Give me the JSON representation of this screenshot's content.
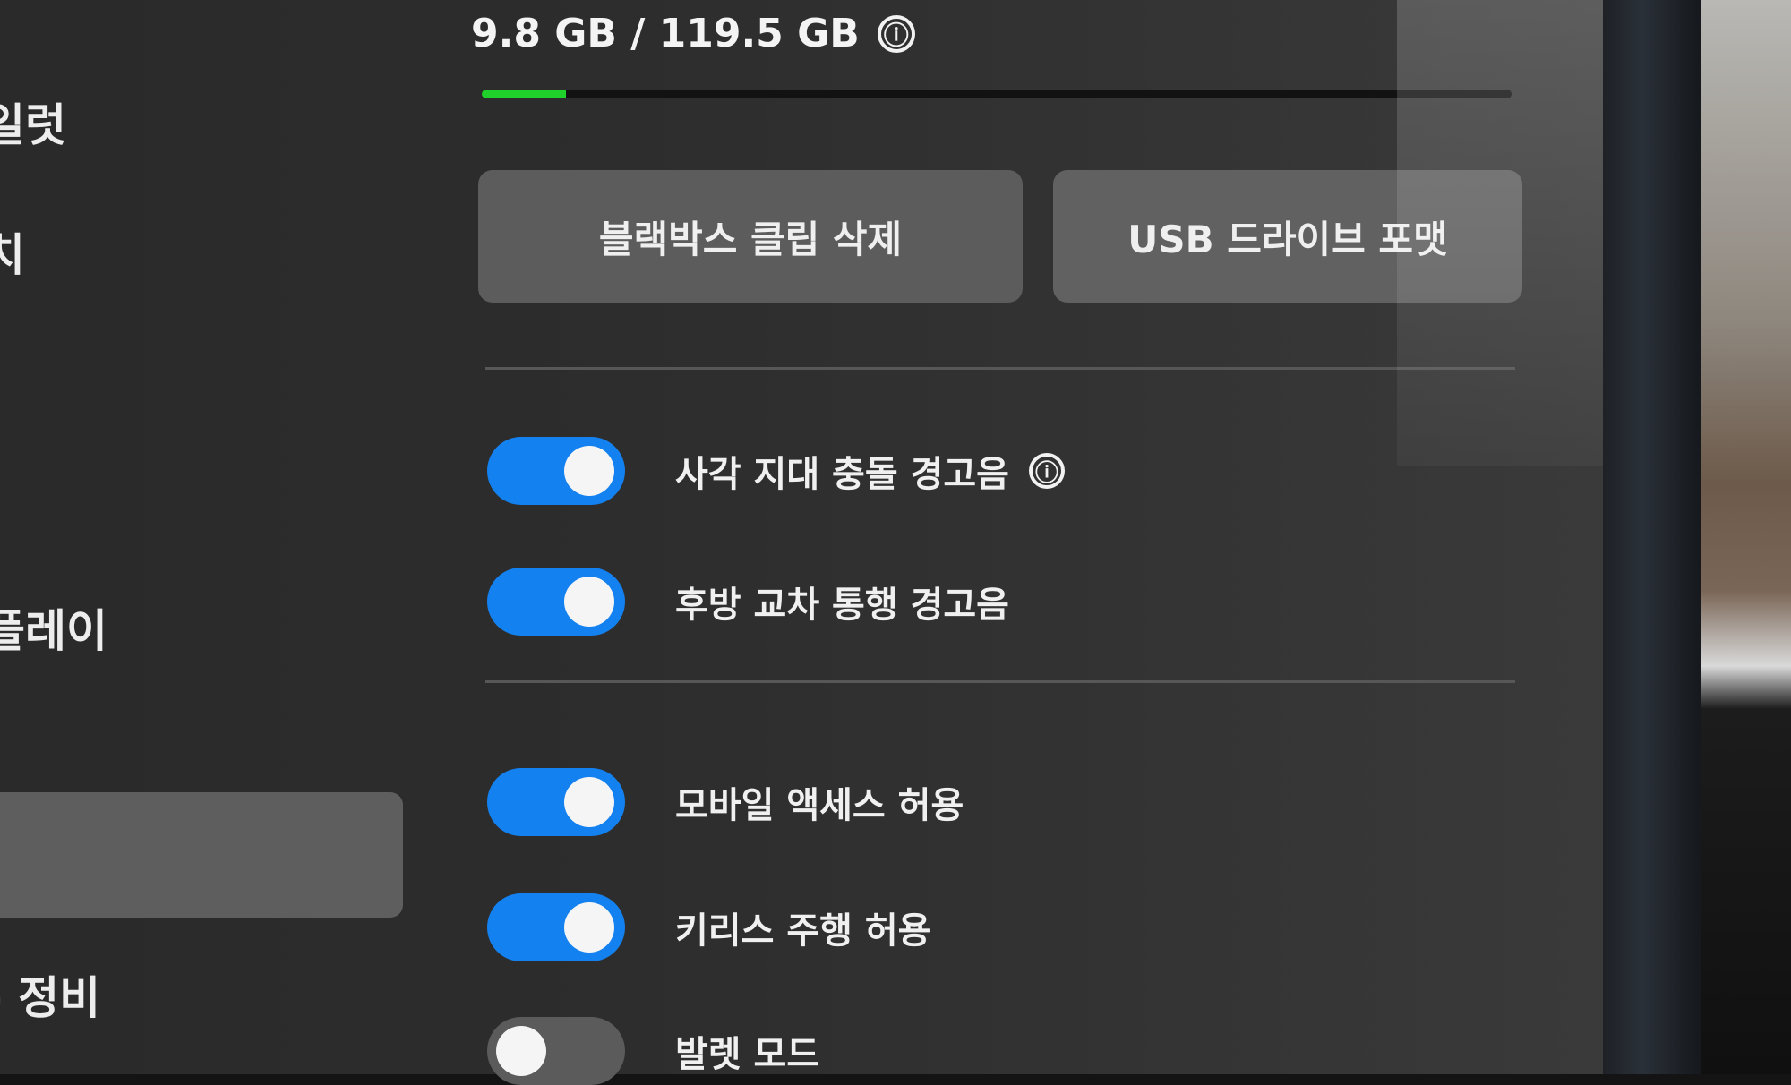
{
  "sidebar": {
    "items": [
      {
        "label": "일럿"
      },
      {
        "label": "치"
      },
      {
        "label": "플레이"
      },
      {
        "label": ""
      },
      {
        "label": "- 정비"
      }
    ]
  },
  "storage": {
    "used_text": "9.8 GB / 119.5 GB",
    "used_fraction": 0.082,
    "info_icon": "ⓘ"
  },
  "actions": {
    "delete_clips": "블랙박스 클립 삭제",
    "format_usb": "USB 드라이브 포맷"
  },
  "toggles": [
    {
      "label": "사각 지대 충돌 경고음",
      "on": true,
      "has_info": true
    },
    {
      "label": "후방 교차 통행 경고음",
      "on": true,
      "has_info": false
    },
    {
      "label": "모바일 액세스 허용",
      "on": true,
      "has_info": false
    },
    {
      "label": "키리스 주행 허용",
      "on": true,
      "has_info": false
    },
    {
      "label": "발렛 모드",
      "on": false,
      "has_info": false
    }
  ],
  "colors": {
    "toggle_on": "#1481f0",
    "progress": "#1fd12a"
  }
}
